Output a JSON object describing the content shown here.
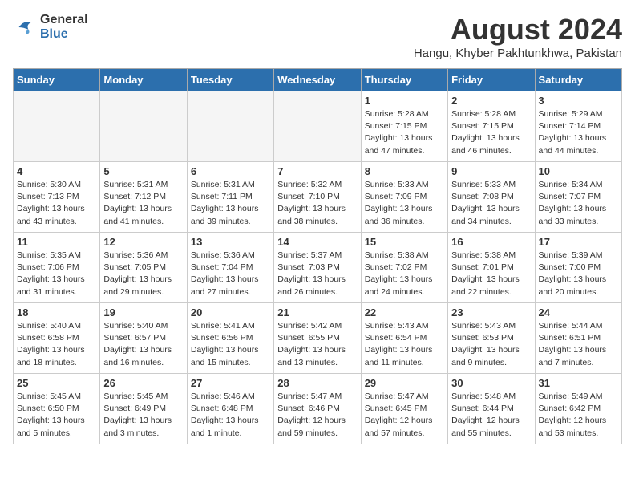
{
  "header": {
    "logo_line1": "General",
    "logo_line2": "Blue",
    "month": "August 2024",
    "location": "Hangu, Khyber Pakhtunkhwa, Pakistan"
  },
  "days_of_week": [
    "Sunday",
    "Monday",
    "Tuesday",
    "Wednesday",
    "Thursday",
    "Friday",
    "Saturday"
  ],
  "weeks": [
    [
      {
        "day": "",
        "info": ""
      },
      {
        "day": "",
        "info": ""
      },
      {
        "day": "",
        "info": ""
      },
      {
        "day": "",
        "info": ""
      },
      {
        "day": "1",
        "info": "Sunrise: 5:28 AM\nSunset: 7:15 PM\nDaylight: 13 hours\nand 47 minutes."
      },
      {
        "day": "2",
        "info": "Sunrise: 5:28 AM\nSunset: 7:15 PM\nDaylight: 13 hours\nand 46 minutes."
      },
      {
        "day": "3",
        "info": "Sunrise: 5:29 AM\nSunset: 7:14 PM\nDaylight: 13 hours\nand 44 minutes."
      }
    ],
    [
      {
        "day": "4",
        "info": "Sunrise: 5:30 AM\nSunset: 7:13 PM\nDaylight: 13 hours\nand 43 minutes."
      },
      {
        "day": "5",
        "info": "Sunrise: 5:31 AM\nSunset: 7:12 PM\nDaylight: 13 hours\nand 41 minutes."
      },
      {
        "day": "6",
        "info": "Sunrise: 5:31 AM\nSunset: 7:11 PM\nDaylight: 13 hours\nand 39 minutes."
      },
      {
        "day": "7",
        "info": "Sunrise: 5:32 AM\nSunset: 7:10 PM\nDaylight: 13 hours\nand 38 minutes."
      },
      {
        "day": "8",
        "info": "Sunrise: 5:33 AM\nSunset: 7:09 PM\nDaylight: 13 hours\nand 36 minutes."
      },
      {
        "day": "9",
        "info": "Sunrise: 5:33 AM\nSunset: 7:08 PM\nDaylight: 13 hours\nand 34 minutes."
      },
      {
        "day": "10",
        "info": "Sunrise: 5:34 AM\nSunset: 7:07 PM\nDaylight: 13 hours\nand 33 minutes."
      }
    ],
    [
      {
        "day": "11",
        "info": "Sunrise: 5:35 AM\nSunset: 7:06 PM\nDaylight: 13 hours\nand 31 minutes."
      },
      {
        "day": "12",
        "info": "Sunrise: 5:36 AM\nSunset: 7:05 PM\nDaylight: 13 hours\nand 29 minutes."
      },
      {
        "day": "13",
        "info": "Sunrise: 5:36 AM\nSunset: 7:04 PM\nDaylight: 13 hours\nand 27 minutes."
      },
      {
        "day": "14",
        "info": "Sunrise: 5:37 AM\nSunset: 7:03 PM\nDaylight: 13 hours\nand 26 minutes."
      },
      {
        "day": "15",
        "info": "Sunrise: 5:38 AM\nSunset: 7:02 PM\nDaylight: 13 hours\nand 24 minutes."
      },
      {
        "day": "16",
        "info": "Sunrise: 5:38 AM\nSunset: 7:01 PM\nDaylight: 13 hours\nand 22 minutes."
      },
      {
        "day": "17",
        "info": "Sunrise: 5:39 AM\nSunset: 7:00 PM\nDaylight: 13 hours\nand 20 minutes."
      }
    ],
    [
      {
        "day": "18",
        "info": "Sunrise: 5:40 AM\nSunset: 6:58 PM\nDaylight: 13 hours\nand 18 minutes."
      },
      {
        "day": "19",
        "info": "Sunrise: 5:40 AM\nSunset: 6:57 PM\nDaylight: 13 hours\nand 16 minutes."
      },
      {
        "day": "20",
        "info": "Sunrise: 5:41 AM\nSunset: 6:56 PM\nDaylight: 13 hours\nand 15 minutes."
      },
      {
        "day": "21",
        "info": "Sunrise: 5:42 AM\nSunset: 6:55 PM\nDaylight: 13 hours\nand 13 minutes."
      },
      {
        "day": "22",
        "info": "Sunrise: 5:43 AM\nSunset: 6:54 PM\nDaylight: 13 hours\nand 11 minutes."
      },
      {
        "day": "23",
        "info": "Sunrise: 5:43 AM\nSunset: 6:53 PM\nDaylight: 13 hours\nand 9 minutes."
      },
      {
        "day": "24",
        "info": "Sunrise: 5:44 AM\nSunset: 6:51 PM\nDaylight: 13 hours\nand 7 minutes."
      }
    ],
    [
      {
        "day": "25",
        "info": "Sunrise: 5:45 AM\nSunset: 6:50 PM\nDaylight: 13 hours\nand 5 minutes."
      },
      {
        "day": "26",
        "info": "Sunrise: 5:45 AM\nSunset: 6:49 PM\nDaylight: 13 hours\nand 3 minutes."
      },
      {
        "day": "27",
        "info": "Sunrise: 5:46 AM\nSunset: 6:48 PM\nDaylight: 13 hours\nand 1 minute."
      },
      {
        "day": "28",
        "info": "Sunrise: 5:47 AM\nSunset: 6:46 PM\nDaylight: 12 hours\nand 59 minutes."
      },
      {
        "day": "29",
        "info": "Sunrise: 5:47 AM\nSunset: 6:45 PM\nDaylight: 12 hours\nand 57 minutes."
      },
      {
        "day": "30",
        "info": "Sunrise: 5:48 AM\nSunset: 6:44 PM\nDaylight: 12 hours\nand 55 minutes."
      },
      {
        "day": "31",
        "info": "Sunrise: 5:49 AM\nSunset: 6:42 PM\nDaylight: 12 hours\nand 53 minutes."
      }
    ]
  ]
}
